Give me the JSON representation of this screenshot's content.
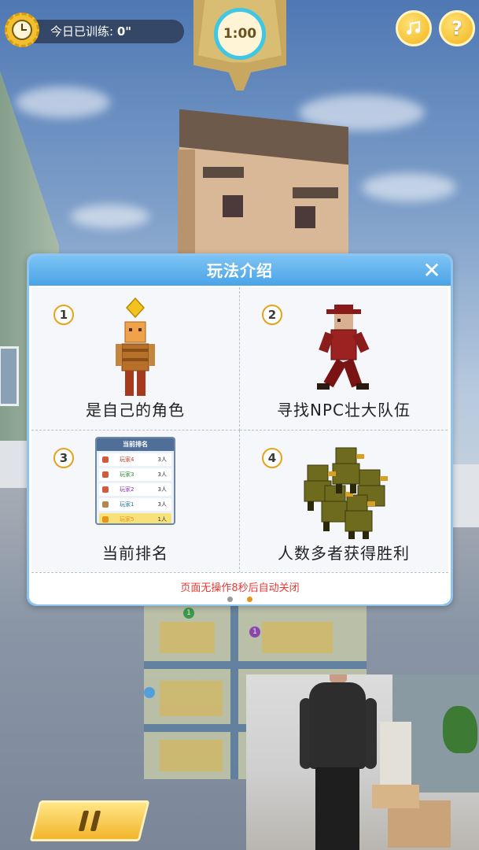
{
  "hud": {
    "training_label": "今日已训练:",
    "training_value": "0\"",
    "timer": "1:00",
    "music_icon": "music-note-icon",
    "help_label": "?",
    "pause_icon": "pause-icon"
  },
  "dialog": {
    "title": "玩法介绍",
    "close_label": "✕",
    "steps": [
      {
        "number": "1",
        "label": "是自己的角色",
        "icon": "player-character-icon"
      },
      {
        "number": "2",
        "label": "寻找NPC壮大队伍",
        "icon": "npc-runner-icon"
      },
      {
        "number": "3",
        "label": "当前排名",
        "icon": "ranking-board-icon"
      },
      {
        "number": "4",
        "label": "人数多者获得胜利",
        "icon": "crowd-icon"
      }
    ],
    "footer_note": "页面无操作8秒后自动关闭",
    "pages": {
      "total": 2,
      "current": 2
    }
  },
  "rank_board": {
    "title": "当前排名",
    "rows": [
      {
        "rank": "5",
        "name": "玩家4",
        "count": "3人"
      },
      {
        "rank": "4",
        "name": "玩家3",
        "count": "3人"
      },
      {
        "rank": "3",
        "name": "玩家2",
        "count": "3人"
      },
      {
        "rank": "2",
        "name": "玩家1",
        "count": "3人"
      },
      {
        "rank": "1",
        "name": "玩家5",
        "count": "1人"
      }
    ]
  },
  "minimap": {
    "markers": [
      "1",
      "1"
    ]
  },
  "colors": {
    "accent_blue": "#4aa3e6",
    "accent_gold": "#f1b41b",
    "timer_ring": "#3ec8e6",
    "note_red": "#e53935"
  }
}
